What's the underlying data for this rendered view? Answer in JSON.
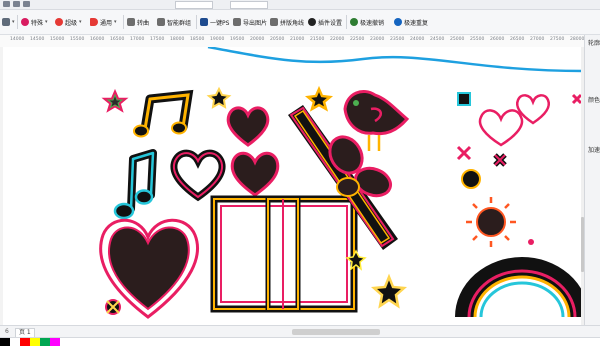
{
  "toolbar": {
    "items": [
      {
        "label": "",
        "icon": "selection-arrows-icon"
      },
      {
        "label": "特殊",
        "icon": "special-icon",
        "color": "#d81b60"
      },
      {
        "label": "超级",
        "icon": "super-icon",
        "color": "#e53935"
      },
      {
        "label": "通用",
        "icon": "general-icon",
        "color": "#e53935"
      },
      {
        "label": "转曲",
        "icon": "convert-curves-icon",
        "color": "#555555"
      },
      {
        "label": "智能群组",
        "icon": "smart-group-icon",
        "color": "#555555"
      },
      {
        "label": "一键PS",
        "icon": "one-click-ps-icon",
        "color": "#1e4b8f"
      },
      {
        "label": "导出图片",
        "icon": "export-image-icon",
        "color": "#555555"
      },
      {
        "label": "拼版角线",
        "icon": "imposition-marks-icon",
        "color": "#555555"
      },
      {
        "label": "插件设置",
        "icon": "plugin-settings-icon",
        "color": "#222222"
      },
      {
        "label": "极速撤销",
        "icon": "fast-undo-icon",
        "color": "#2e7d32"
      },
      {
        "label": "极速重复",
        "icon": "fast-redo-icon",
        "color": "#1565c0"
      }
    ]
  },
  "ruler": {
    "ticks": [
      "14000",
      "14500",
      "15000",
      "15500",
      "16000",
      "16500",
      "17000",
      "17500",
      "18000",
      "18500",
      "19000",
      "19500",
      "20000",
      "20500",
      "21000",
      "21500",
      "22000",
      "22500",
      "23000",
      "23500",
      "24000",
      "24500",
      "25000",
      "25500",
      "26000",
      "26500",
      "27000",
      "27500",
      "28000",
      "28500"
    ]
  },
  "right_panel": {
    "labels": [
      "轮廓",
      "颜色",
      "加速"
    ]
  },
  "bottom": {
    "page_count": "6",
    "page_tab": "页 1"
  },
  "palette": {
    "colors": [
      "#000000",
      "#ffffff",
      "#ff0000",
      "#ffff00",
      "#00a651",
      "#ff00ff"
    ]
  }
}
